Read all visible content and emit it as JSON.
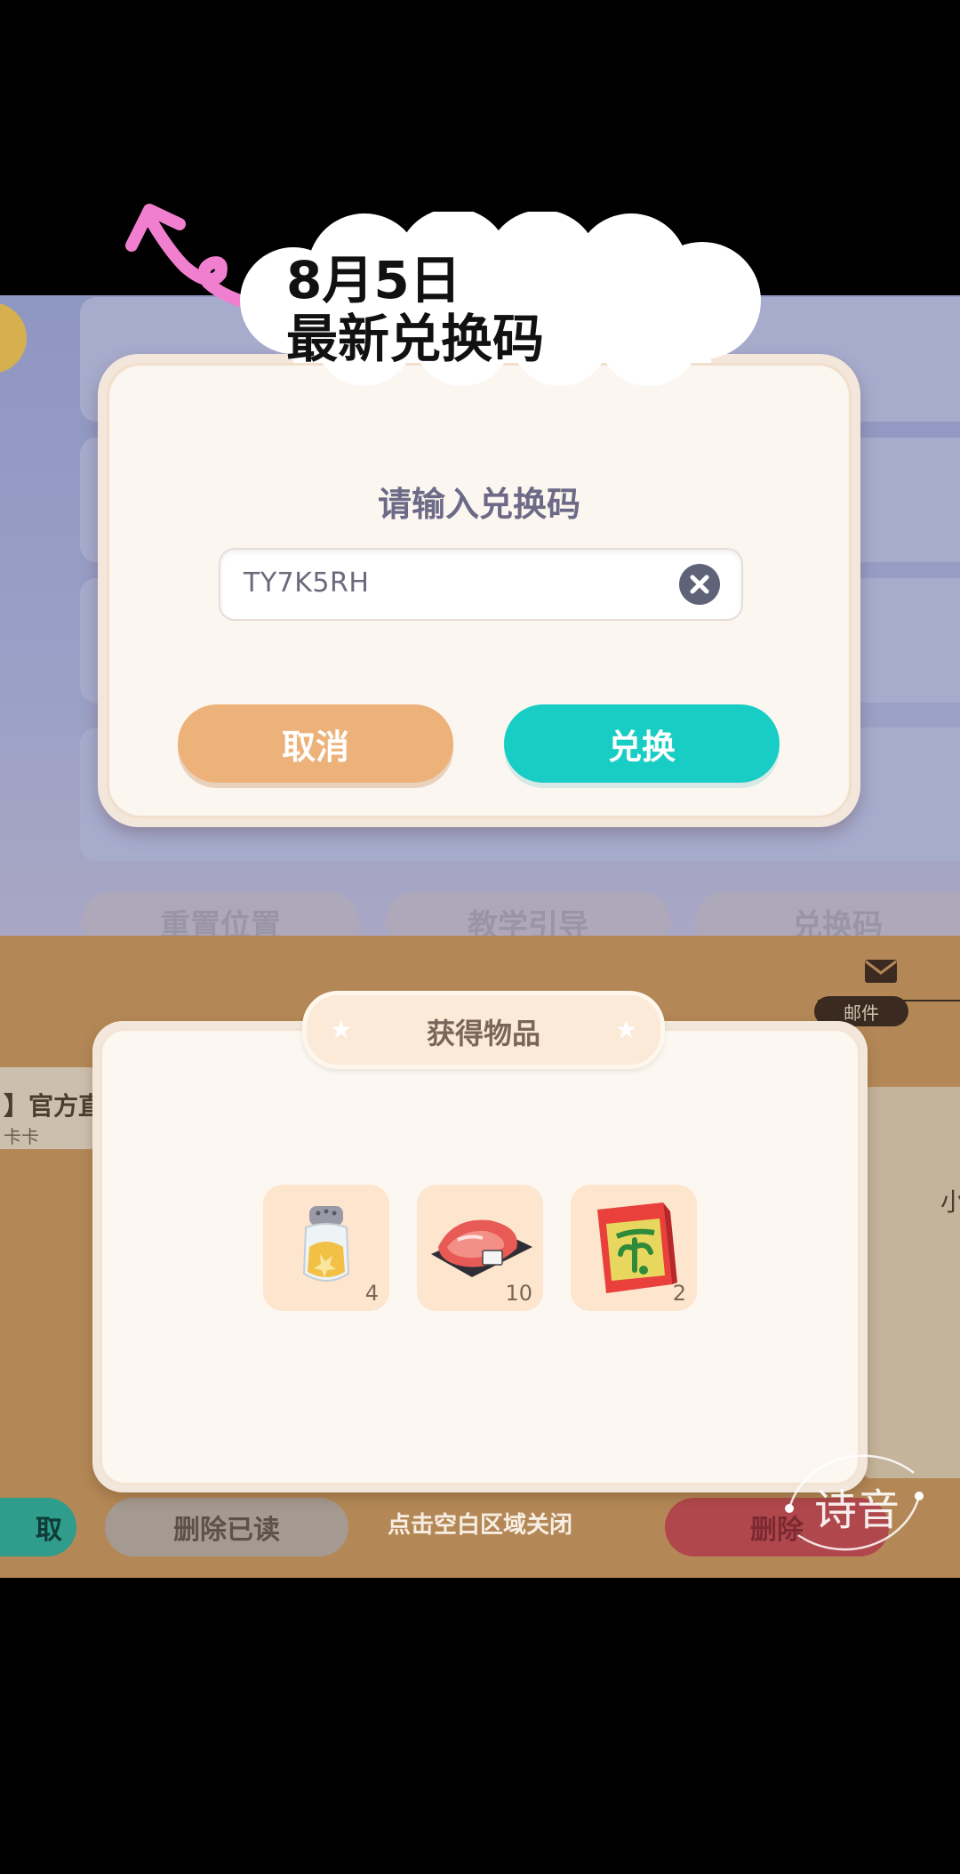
{
  "announcement": {
    "line1": "8月5日",
    "line2": "最新兑换码"
  },
  "settings_screen": {
    "bg_row1_label": "小",
    "tabs": [
      "重置位置",
      "教学引导",
      "兑换码"
    ]
  },
  "redeem_dialog": {
    "title": "请输入兑换码",
    "code_value": "TY7K5RH",
    "cancel_label": "取消",
    "redeem_label": "兑换"
  },
  "mail_screen": {
    "mail_label": "邮件",
    "left_card_title": "】官方直",
    "left_card_sub": "卡卡",
    "right_char": "小",
    "claim_label": "取",
    "delete_read_label": "删除已读",
    "close_hint": "点击空白区域关闭",
    "delete_label": "删除"
  },
  "items_dialog": {
    "title": "获得物品",
    "items": [
      {
        "icon": "seasoning-jar-icon",
        "qty": "4"
      },
      {
        "icon": "raw-steak-icon",
        "qty": "10"
      },
      {
        "icon": "seed-packet-icon",
        "qty": "2"
      }
    ]
  },
  "watermark": {
    "text": "诗音"
  },
  "colors": {
    "cancel": "#edb27a",
    "redeem": "#18cdc3",
    "top_bg": "#9aa0c6",
    "bottom_bg": "#b48856"
  }
}
